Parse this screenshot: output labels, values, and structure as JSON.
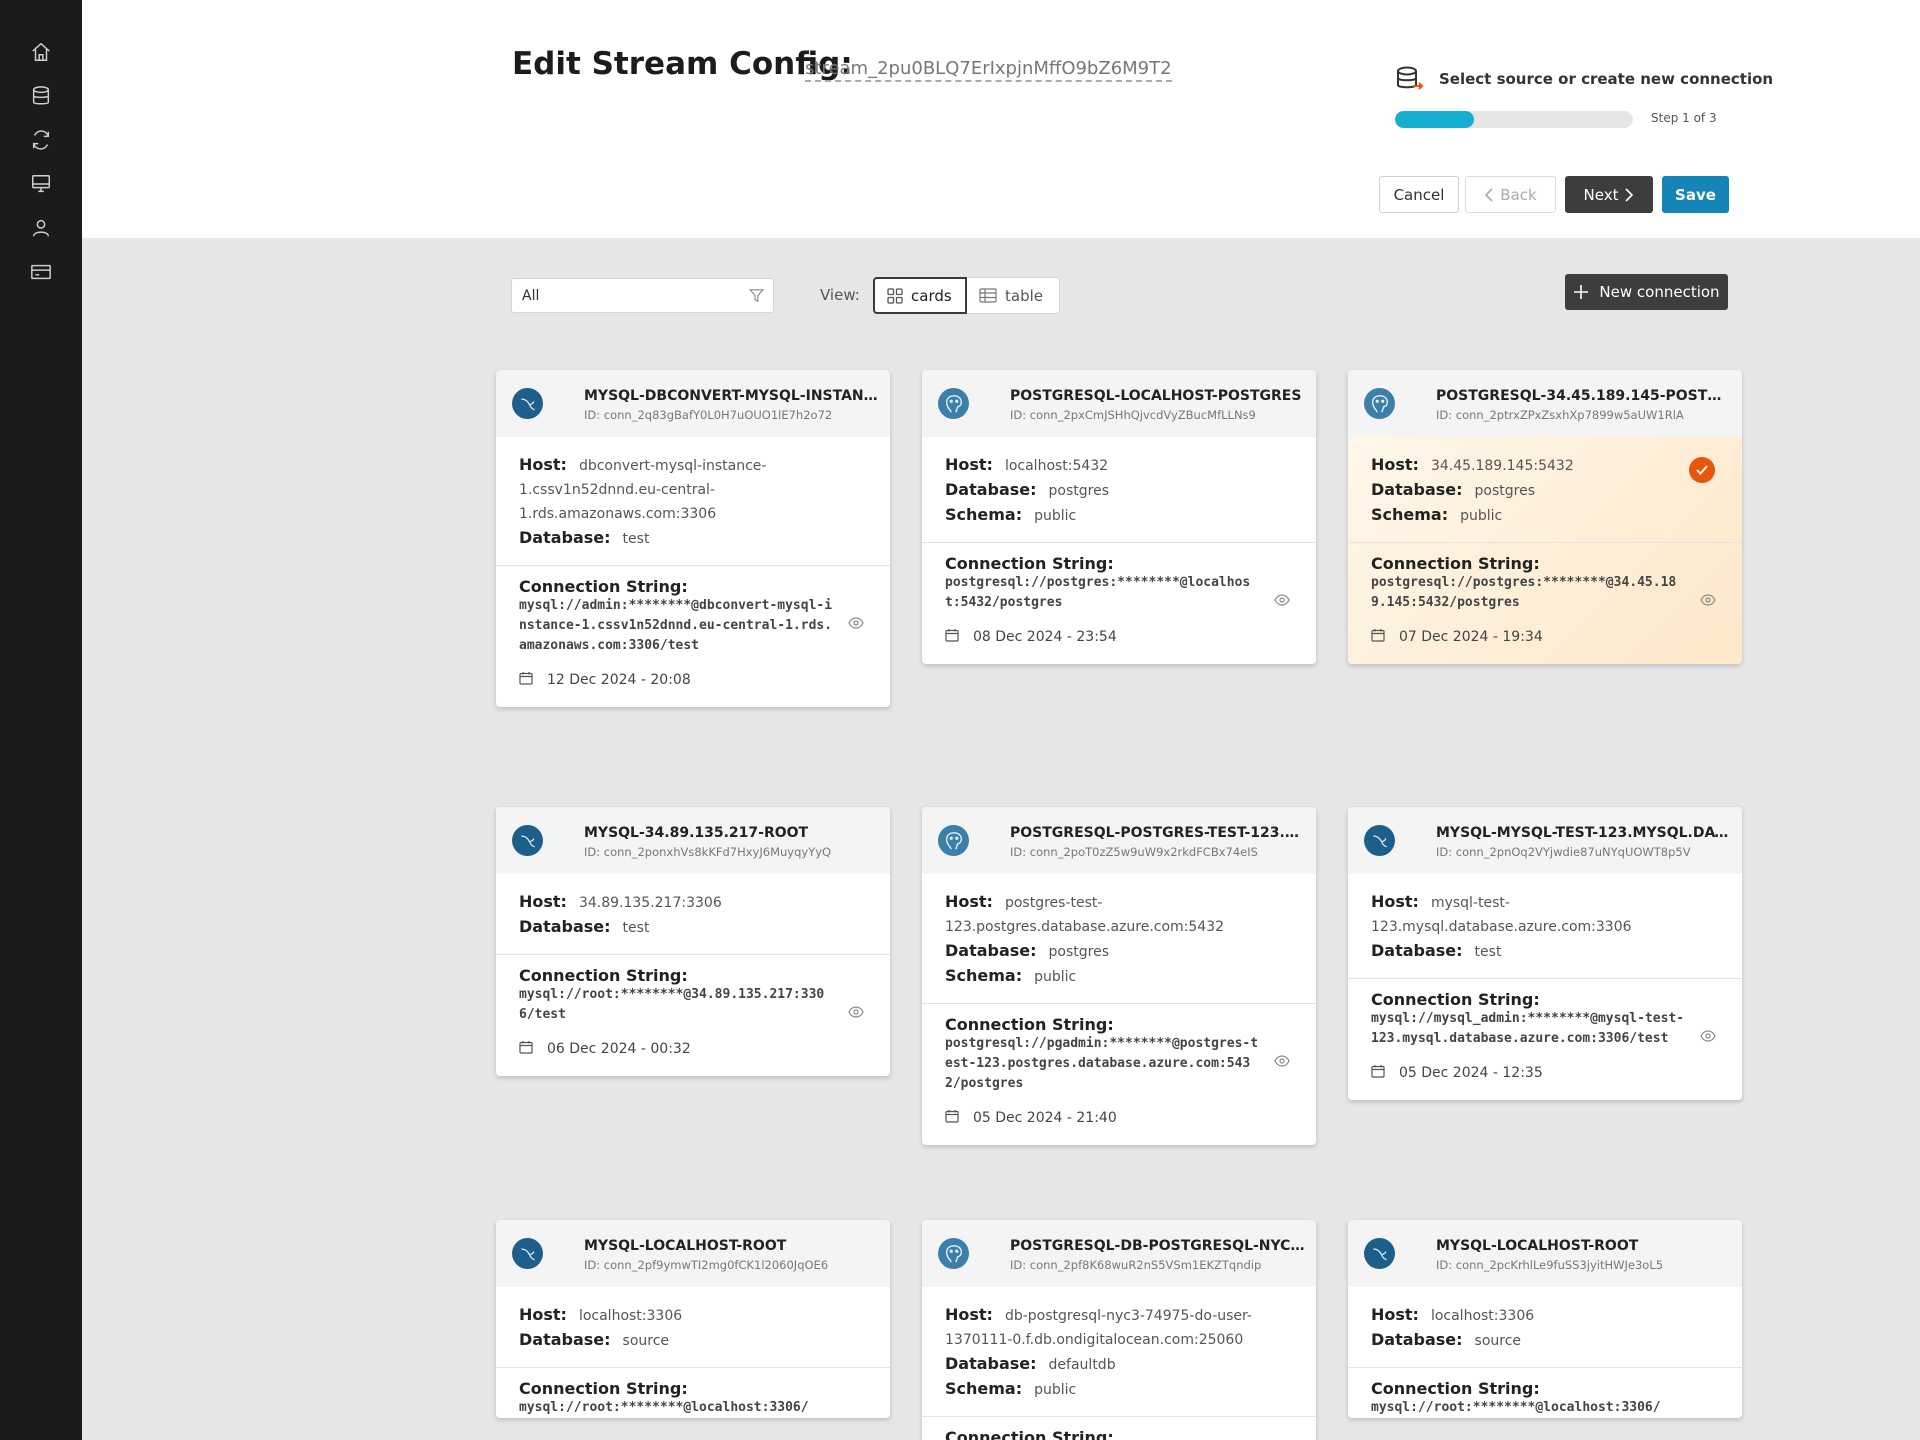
{
  "sidebar": {
    "icons": [
      "home-icon",
      "database-icon",
      "sync-icon",
      "monitor-icon",
      "user-icon",
      "billing-icon"
    ]
  },
  "header": {
    "title": "Edit Stream Config:",
    "stream_id": "stream_2pu0BLQ7ErIxpjnMffO9bZ6M9T2",
    "step_title": "Select source or create new connection",
    "step_count": "Step 1 of 3",
    "progress": 0.33,
    "buttons": {
      "cancel": "Cancel",
      "back": "Back",
      "next": "Next",
      "save": "Save"
    }
  },
  "toolbar": {
    "filter_value": "All",
    "view_label": "View:",
    "view_cards": "cards",
    "view_table": "table",
    "new_connection": "New connection"
  },
  "labels": {
    "host": "Host:",
    "database": "Database:",
    "schema": "Schema:",
    "connection_string": "Connection String:"
  },
  "colors": {
    "accent": "#1584b6",
    "progress": "#15aed0",
    "selected_check": "#e8560b",
    "sidebar": "#1b1b1b"
  },
  "cards": [
    {
      "type": "mysql",
      "name": "MYSQL-DBCONVERT-MYSQL-INSTANCE-...",
      "id": "ID: conn_2q83gBafY0L0H7uOUO1lE7h2o72",
      "host": "dbconvert-mysql-instance-1.cssv1n52dnnd.eu-central-1.rds.amazonaws.com:3306",
      "database": "test",
      "schema": null,
      "conn": "mysql://admin:********@dbconvert-mysql-instance-1.cssv1n52dnnd.eu-central-1.rds.amazonaws.com:3306/test",
      "date": "12 Dec 2024 - 20:08",
      "selected": false
    },
    {
      "type": "postgres",
      "name": "POSTGRESQL-LOCALHOST-POSTGRES",
      "id": "ID: conn_2pxCmJSHhQjvcdVyZBucMfLLNs9",
      "host": "localhost:5432",
      "database": "postgres",
      "schema": "public",
      "conn": "postgresql://postgres:********@localhost:5432/postgres",
      "date": "08 Dec 2024 - 23:54",
      "selected": false
    },
    {
      "type": "postgres",
      "name": "POSTGRESQL-34.45.189.145-POSTGRES",
      "id": "ID: conn_2ptrxZPxZsxhXp7899w5aUW1RlA",
      "host": "34.45.189.145:5432",
      "database": "postgres",
      "schema": "public",
      "conn": "postgresql://postgres:********@34.45.189.145:5432/postgres",
      "date": "07 Dec 2024 - 19:34",
      "selected": true
    },
    {
      "type": "mysql",
      "name": "MYSQL-34.89.135.217-ROOT",
      "id": "ID: conn_2ponxhVs8kKFd7HxyJ6MuyqyYyQ",
      "host": "34.89.135.217:3306",
      "database": "test",
      "schema": null,
      "conn": "mysql://root:********@34.89.135.217:3306/test",
      "date": "06 Dec 2024 - 00:32",
      "selected": false
    },
    {
      "type": "postgres",
      "name": "POSTGRESQL-POSTGRES-TEST-123.POST...",
      "id": "ID: conn_2poT0zZ5w9uW9x2rkdFCBx74eIS",
      "host": "postgres-test-123.postgres.database.azure.com:5432",
      "database": "postgres",
      "schema": "public",
      "conn": "postgresql://pgadmin:********@postgres-test-123.postgres.database.azure.com:5432/postgres",
      "date": "05 Dec 2024 - 21:40",
      "selected": false
    },
    {
      "type": "mysql",
      "name": "MYSQL-MYSQL-TEST-123.MYSQL.DATAB...",
      "id": "ID: conn_2pnOq2VYjwdie87uNYqUOWT8p5V",
      "host": "mysql-test-123.mysql.database.azure.com:3306",
      "database": "test",
      "schema": null,
      "conn": "mysql://mysql_admin:********@mysql-test-123.mysql.database.azure.com:3306/test",
      "date": "05 Dec 2024 - 12:35",
      "selected": false
    },
    {
      "type": "mysql",
      "name": "MYSQL-LOCALHOST-ROOT",
      "id": "ID: conn_2pf9ymwTI2mg0fCK1l2060JqOE6",
      "host": "localhost:3306",
      "database": "source",
      "schema": null,
      "conn": "mysql://root:********@localhost:3306/",
      "date": "",
      "selected": false
    },
    {
      "type": "postgres",
      "name": "POSTGRESQL-DB-POSTGRESQL-NYC3-74...",
      "id": "ID: conn_2pf8K68wuR2nS5VSm1EKZTqndip",
      "host": "db-postgresql-nyc3-74975-do-user-1370111-0.f.db.ondigitalocean.com:25060",
      "database": "defaultdb",
      "schema": "public",
      "conn": "",
      "date": "",
      "selected": false
    },
    {
      "type": "mysql",
      "name": "MYSQL-LOCALHOST-ROOT",
      "id": "ID: conn_2pcKrhlLe9fuSS3jyitHWJe3oL5",
      "host": "localhost:3306",
      "database": "source",
      "schema": null,
      "conn": "mysql://root:********@localhost:3306/",
      "date": "",
      "selected": false
    }
  ]
}
